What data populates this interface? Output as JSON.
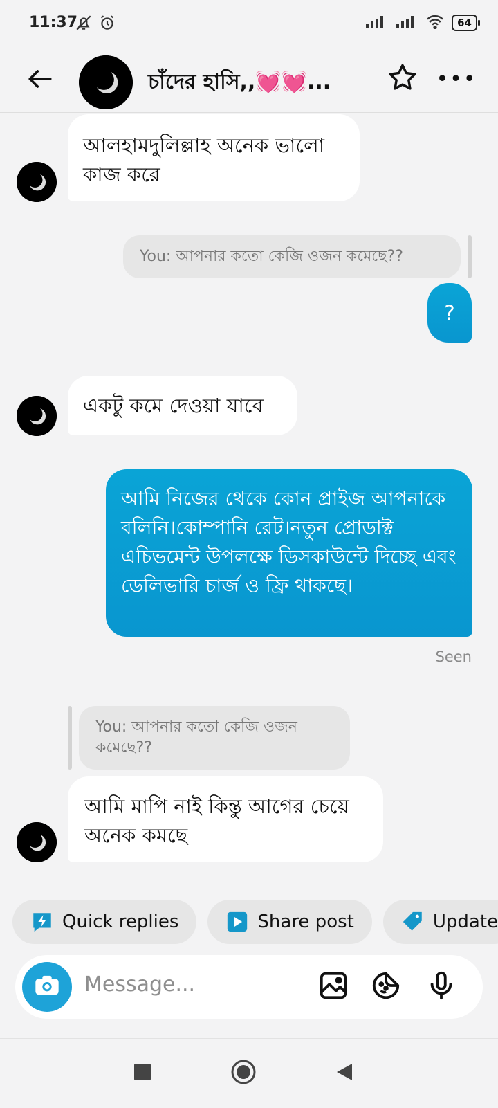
{
  "status_bar": {
    "time": "11:37",
    "battery": "64"
  },
  "header": {
    "title": "চাঁদের হাসি,,💓💓...",
    "back_icon": "arrow-left-icon",
    "star_icon": "star-outline-icon",
    "more_icon": "more-horizontal-icon",
    "more_label": "•••"
  },
  "messages": [
    {
      "type": "received",
      "text": "আলহামদুলিল্লাহ অনেক ভালো কাজ করে"
    },
    {
      "type": "reply_preview",
      "text": "You: আপনার কতো কেজি ওজন কমেছে??"
    },
    {
      "type": "sent",
      "text": "?"
    },
    {
      "type": "received",
      "text": "একটু কমে দেওয়া যাবে"
    },
    {
      "type": "sent",
      "text": "আমি নিজের থেকে কোন প্রাইজ আপনাকে বলিনি।কোম্পানি রেট।নতুন প্রোডাক্ট এচিভমেন্ট উপলক্ষে ডিসকাউন্টে দিচ্ছে এবং ডেলিভারি চার্জ ও ফ্রি থাকছে।"
    },
    {
      "type": "reply_preview",
      "text": "You: আপনার কতো কেজি ওজন কমেছে??"
    },
    {
      "type": "received",
      "text": "আমি মাপি নাই কিন্তু আগের চেয়ে অনেক কমছে"
    }
  ],
  "seen_label": "Seen",
  "quick_actions": [
    {
      "label": "Quick replies",
      "icon": "lightning-bubble-icon"
    },
    {
      "label": "Share post",
      "icon": "play-square-icon"
    },
    {
      "label": "Update",
      "icon": "tag-icon"
    }
  ],
  "composer": {
    "placeholder": "Message...",
    "camera_icon": "camera-icon",
    "gallery_icon": "image-icon",
    "sticker_icon": "sticker-icon",
    "mic_icon": "microphone-icon"
  },
  "colors": {
    "accent": "#0aa0d4",
    "sent_bubble": "#0996cf",
    "received_bubble": "#ffffff",
    "background": "#f3f3f4"
  }
}
